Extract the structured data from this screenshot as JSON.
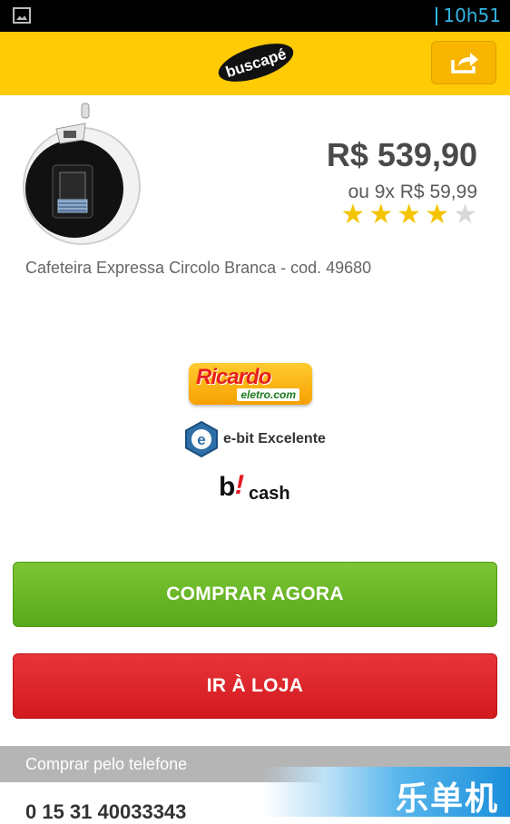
{
  "status_bar": {
    "time": "10h51"
  },
  "header": {
    "logo_text": "buscapé",
    "share_icon": "share-icon",
    "brand_color": "#ffcb05"
  },
  "product": {
    "price": "R$ 539,90",
    "installment": "ou 9x R$ 59,99",
    "rating": 4,
    "rating_max": 5,
    "name": "Cafeteira Expressa Circolo Branca - cod. 49680"
  },
  "stores": {
    "ricardo_main": "Ricardo",
    "ricardo_sub": "eletro.com",
    "ebit_label": "e-bit Excelente",
    "bcash_b": "b",
    "bcash_mark": "!",
    "bcash_cash": "cash"
  },
  "actions": {
    "buy_label": "COMPRAR AGORA",
    "buy_color": "#66b523",
    "store_label": "IR À LOJA",
    "store_color": "#dd2328"
  },
  "phone": {
    "header": "Comprar pelo telefone",
    "number": "0 15 31 40033343"
  },
  "watermark": {
    "text": "乐单机"
  }
}
